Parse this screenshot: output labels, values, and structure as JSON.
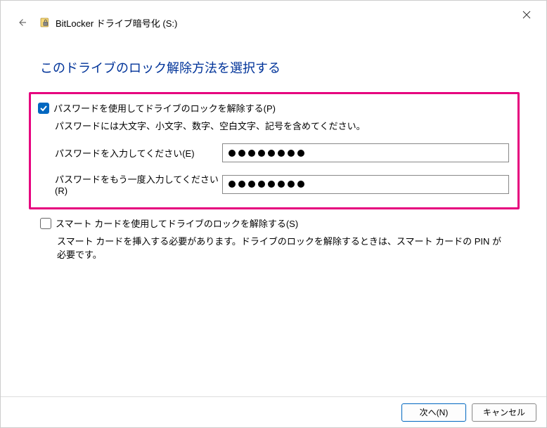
{
  "window": {
    "title": "BitLocker ドライブ暗号化 (S:)"
  },
  "heading": "このドライブのロック解除方法を選択する",
  "password_option": {
    "checked": true,
    "label": "パスワードを使用してドライブのロックを解除する(P)",
    "hint": "パスワードには大文字、小文字、数字、空白文字、記号を含めてください。",
    "field1_label": "パスワードを入力してください(E)",
    "field1_value": "••••••••",
    "field2_label": "パスワードをもう一度入力してください(R)",
    "field2_value": "••••••••"
  },
  "smartcard_option": {
    "checked": false,
    "label": "スマート カードを使用してドライブのロックを解除する(S)",
    "hint": "スマート カードを挿入する必要があります。ドライブのロックを解除するときは、スマート カードの PIN が必要です。"
  },
  "footer": {
    "next": "次へ(N)",
    "cancel": "キャンセル"
  }
}
